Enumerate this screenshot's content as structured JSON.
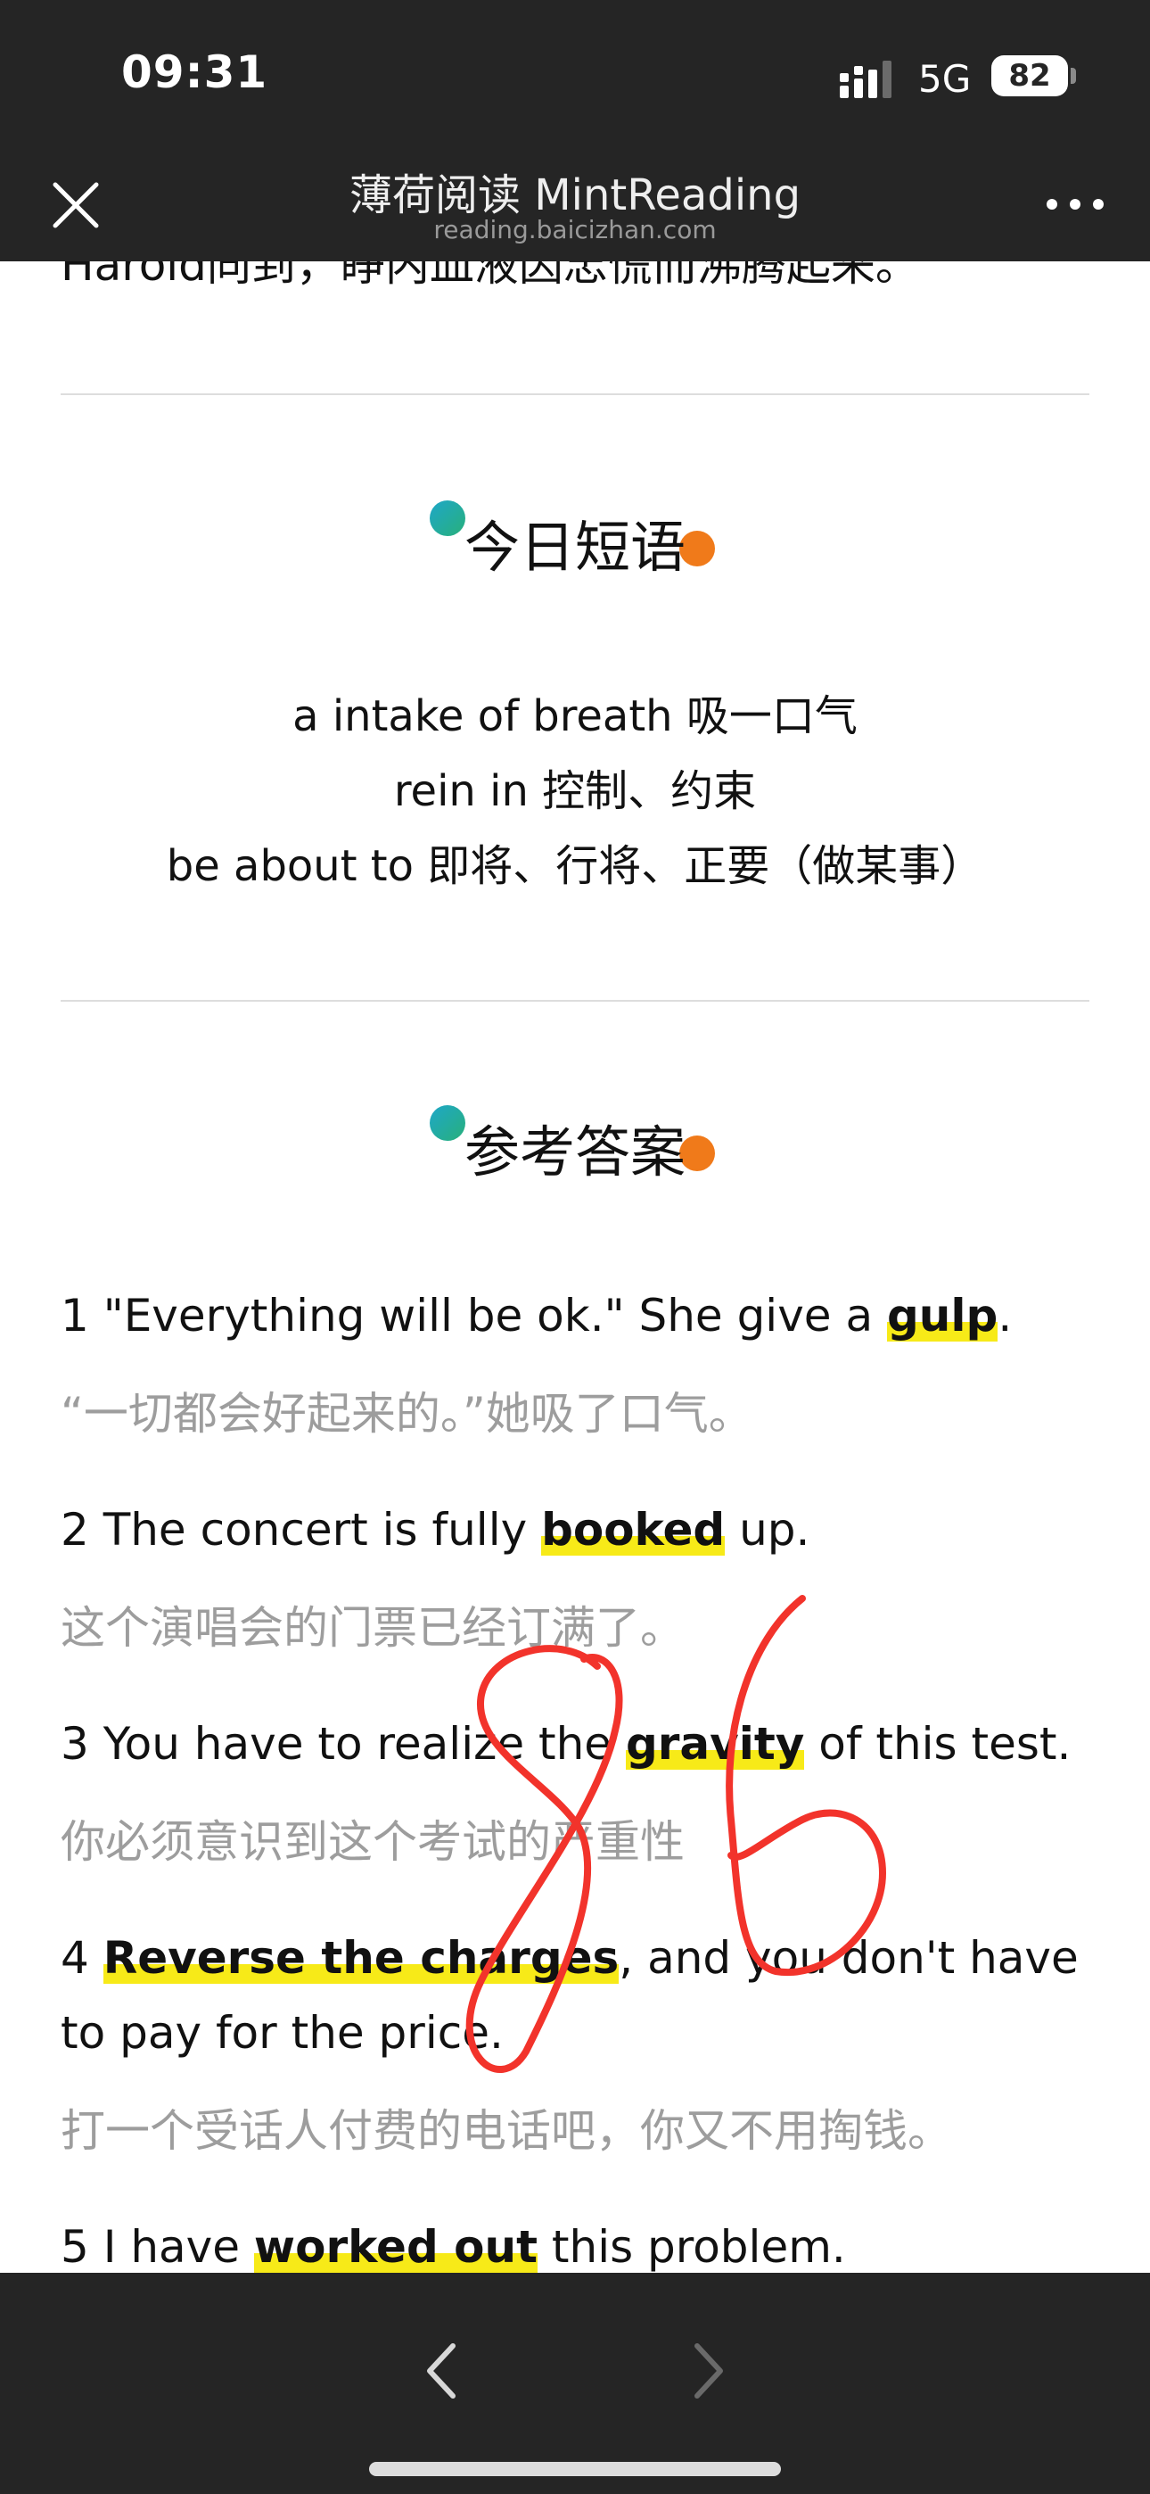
{
  "status_bar": {
    "time": "09:31",
    "network": "5G",
    "battery": "82"
  },
  "nav_bar": {
    "title": "薄荷阅读 MintReading",
    "subtitle": "reading.baicizhan.com",
    "close_icon": "close-icon",
    "more_icon": "more-dots-icon"
  },
  "article": {
    "clipped_top_line": "Harold同到，睁内皿液因忠慌而沸腾起来。"
  },
  "phrases_section": {
    "heading": "今日短语",
    "items": [
      "a intake of breath 吸一口气",
      "rein in 控制、约束",
      "be about to 即将、行将、正要（做某事）"
    ]
  },
  "answers_section": {
    "heading": "参考答案",
    "items": [
      {
        "en_before": "1 \"Everything will be ok.\" She give a ",
        "en_highlight": "gulp",
        "en_after": ".",
        "zh": "“一切都会好起来的。”她吸了口气。"
      },
      {
        "en_before": "2 The concert is fully ",
        "en_highlight": "booked",
        "en_after": " up.",
        "zh": "这个演唱会的门票已经订满了。"
      },
      {
        "en_before": "3 You have to realize the ",
        "en_highlight": "gravity",
        "en_after": " of this test.",
        "zh": "你必须意识到这个考试的严重性"
      },
      {
        "en_before": "4 ",
        "en_highlight": "Reverse the charges",
        "en_after": ", and you don't have to pay for the price.",
        "zh": "打一个受话人付费的电话吧，你又不用掏钱。"
      },
      {
        "en_before": "5 I have ",
        "en_highlight": "worked out",
        "en_after": " this problem.",
        "zh": ""
      }
    ]
  },
  "handwriting": {
    "text": "86",
    "color": "#f2332b"
  },
  "bottom_bar": {
    "back_icon": "chevron-left-icon",
    "forward_icon": "chevron-right-icon"
  },
  "colors": {
    "bar_background": "#252525",
    "highlight": "#f7ea18",
    "dot_teal": "#1ea7c9",
    "dot_orange": "#f07a1a",
    "translation_gray": "#9d9d9d"
  }
}
